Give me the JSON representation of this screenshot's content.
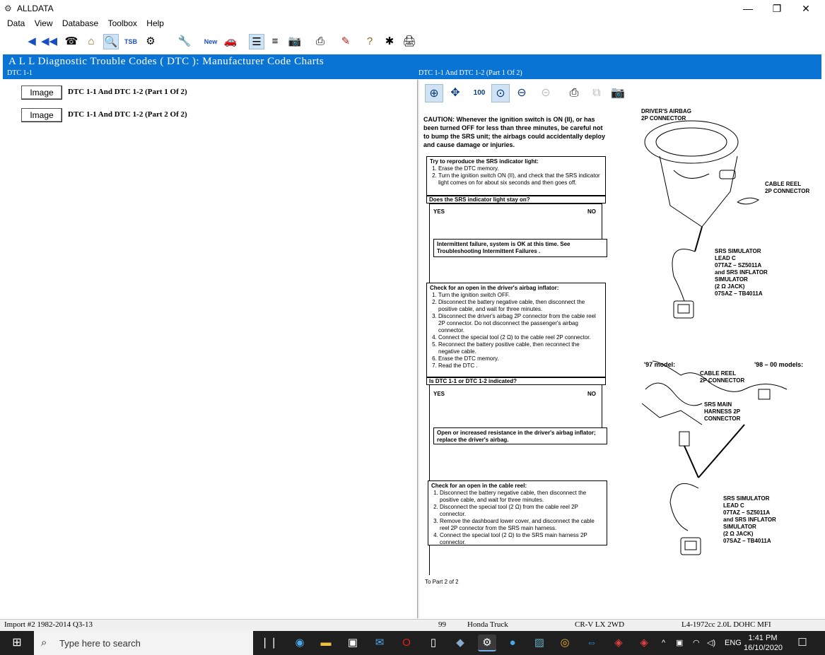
{
  "window": {
    "title": "ALLDATA",
    "minimize": "—",
    "restore": "❐",
    "close": "✕"
  },
  "menu": [
    "Data",
    "View",
    "Database",
    "Toolbox",
    "Help"
  ],
  "toolbar_icons": [
    "back-icon",
    "back-fast-icon",
    "phone-icon",
    "home-icon",
    "search-vehicle-icon",
    "tsb-icon",
    "component-icon",
    "wrench-icon",
    "new-car-icon",
    "new-car-2-icon",
    "list-view-icon",
    "text-view-icon",
    "camera-icon",
    "print-icon",
    "note-icon",
    "help-icon",
    "settings-icon",
    "fax-icon"
  ],
  "header": {
    "title": "A L L  Diagnostic Trouble Codes ( DTC ):  Manufacturer Code Charts",
    "left_sub": "DTC 1-1",
    "right_sub": "DTC 1-1 And DTC 1-2 (Part 1 Of 2)"
  },
  "left": {
    "items": [
      {
        "button": "Image",
        "label": "DTC 1-1 And DTC 1-2 (Part 1 Of 2)"
      },
      {
        "button": "Image",
        "label": "DTC 1-1 And DTC 1-2 (Part 2 Of 2)"
      }
    ]
  },
  "viewer_icons": [
    "zoom-in-icon",
    "pan-icon",
    "zoom-100-icon",
    "zoom-fit-icon",
    "zoom-out-icon",
    "zoom-disabled-icon",
    "print-icon",
    "copy-icon",
    "camera-icon"
  ],
  "doc": {
    "caution": "CAUTION: Whenever the ignition switch is ON (II), or has been turned OFF for less than three minutes, be careful not to bump the SRS unit; the airbags could accidentally deploy and cause damage or injuries.",
    "box1": {
      "title": "Try to reproduce the SRS indicator light:",
      "steps": [
        "Erase the DTC memory.",
        "Turn the ignition switch ON (II), and check that the SRS indicator light comes on for about six seconds and then goes off."
      ]
    },
    "q1": "Does the SRS indicator light stay on?",
    "yes": "YES",
    "no": "NO",
    "result1": "Intermittent failure, system is OK at this time. See Troubleshooting Intermittent Failures .",
    "box2": {
      "title": "Check for an open in the driver's airbag inflator:",
      "steps": [
        "Turn the ignition switch OFF.",
        "Disconnect the battery negative cable, then disconnect the positive cable, and wait for three minutes.",
        "Disconnect the driver's airbag 2P connector from the cable reel 2P connector. Do not disconnect the passenger's airbag connector.",
        "Connect the special tool (2 Ω) to the cable reel 2P connector.",
        "Reconnect the battery positive cable, then reconnect the negative cable.",
        "Erase the DTC memory.",
        "Read the DTC ."
      ]
    },
    "q2": "Is DTC 1-1 or DTC 1-2 indicated?",
    "result2": "Open or increased resistance in the driver's airbag inflator; replace the driver's airbag.",
    "box3": {
      "title": "Check for an open in the cable reel:",
      "steps": [
        "Disconnect the battery negative cable, then disconnect the positive cable, and wait for three minutes.",
        "Disconnect the special tool (2 Ω) from the cable reel 2P connector.",
        "Remove the dashboard lower cover, and disconnect the cable reel 2P connector from the SRS main harness.",
        "Connect the special tool (2 Ω) to the SRS main harness 2P connector."
      ]
    },
    "to_part": "To Part 2 of 2",
    "labels": {
      "drivers_airbag": "DRIVER'S AIRBAG\n2P CONNECTOR",
      "cable_reel": "CABLE REEL\n2P CONNECTOR",
      "simulator1": "SRS SIMULATOR\nLEAD C\n07TAZ – SZ5011A\nand SRS INFLATOR\nSIMULATOR\n(2 Ω JACK)\n07SAZ – TB4011A",
      "model97": "'97 model:",
      "model98": "'98 – 00 models:",
      "cable_reel2": "CABLE REEL\n2P CONNECTOR",
      "srs_main": "SRS MAIN\nHARNESS 2P\nCONNECTOR",
      "simulator2": "SRS SIMULATOR\nLEAD C\n07TAZ – SZ5011A\nand SRS INFLATOR\nSIMULATOR\n(2 Ω JACK)\n07SAZ – TB4011A"
    }
  },
  "status": {
    "import": "Import #2 1982-2014 Q3-13",
    "year": "99",
    "make": "Honda Truck",
    "model": "CR-V LX 2WD",
    "engine": "L4-1972cc 2.0L DOHC MFI"
  },
  "taskbar": {
    "search_placeholder": "Type here to search",
    "lang": "ENG",
    "time": "1:41 PM",
    "date": "16/10/2020"
  }
}
